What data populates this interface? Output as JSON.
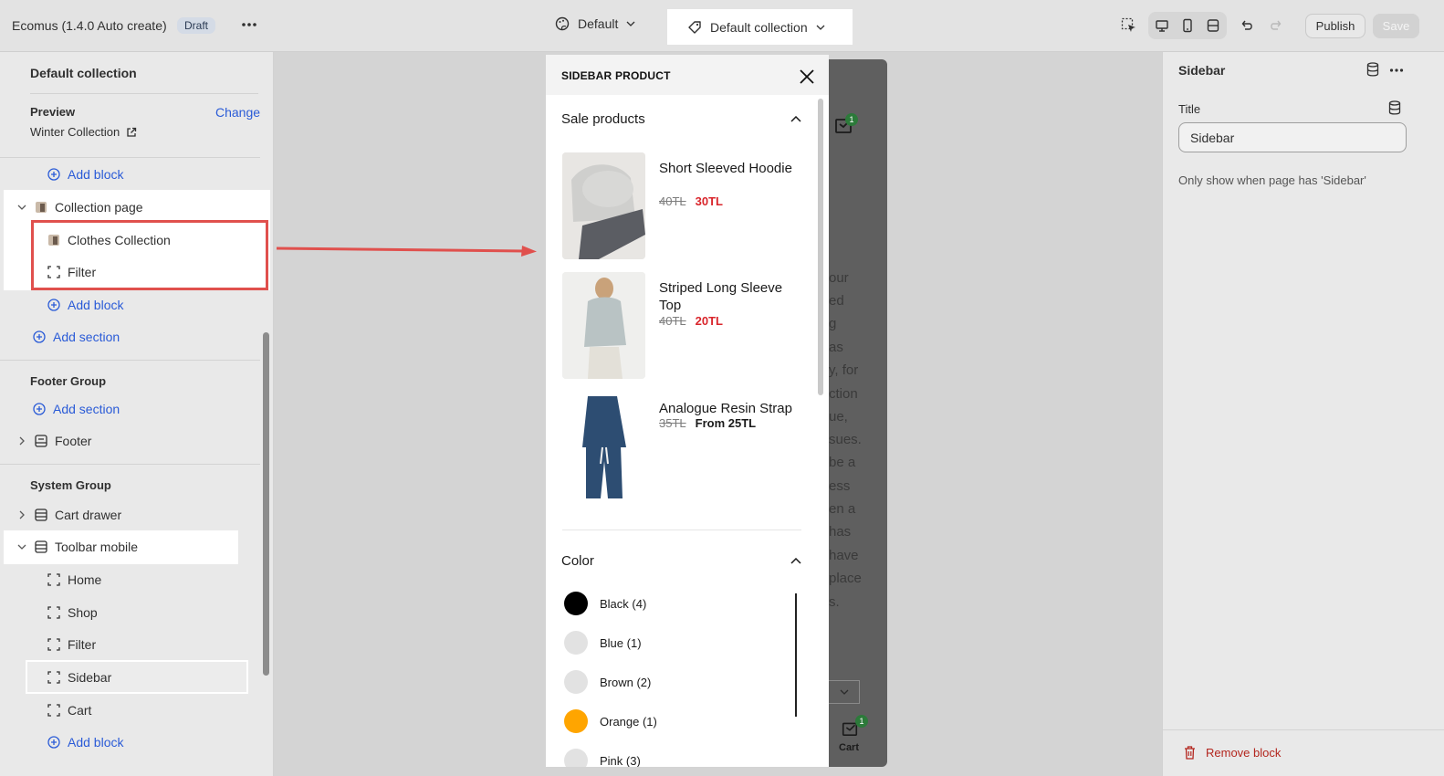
{
  "topbar": {
    "app_title": "Ecomus (1.4.0 Auto create)",
    "status_badge": "Draft",
    "theme_select": "Default",
    "template_select": "Default collection",
    "publish_label": "Publish",
    "save_label": "Save"
  },
  "left_panel": {
    "title": "Default collection",
    "preview_label": "Preview",
    "change_label": "Change",
    "preview_value": "Winter Collection",
    "add_block": "Add block",
    "add_section": "Add section",
    "collection_page": "Collection page",
    "clothes_collection": "Clothes Collection",
    "filter": "Filter",
    "footer_group": "Footer Group",
    "footer": "Footer",
    "system_group": "System Group",
    "cart_drawer": "Cart drawer",
    "toolbar_mobile": "Toolbar mobile",
    "toolbar_items": [
      "Home",
      "Shop",
      "Filter",
      "Sidebar",
      "Cart"
    ]
  },
  "drawer": {
    "title": "SIDEBAR PRODUCT",
    "sale_section": "Sale products",
    "products": [
      {
        "name": "Short Sleeved Hoodie",
        "old_price": "40TL",
        "new_price": "30TL"
      },
      {
        "name": "Striped Long Sleeve Top",
        "old_price": "40TL",
        "new_price": "20TL"
      },
      {
        "name": "Analogue Resin Strap",
        "old_price": "35TL",
        "new_price": "From 25TL"
      }
    ],
    "color_section": "Color",
    "colors": [
      {
        "label": "Black (4)",
        "hex": "#000000"
      },
      {
        "label": "Blue (1)",
        "hex": "#e2e2e2"
      },
      {
        "label": "Brown (2)",
        "hex": "#e2e2e2"
      },
      {
        "label": "Orange (1)",
        "hex": "#ffa500"
      },
      {
        "label": "Pink (3)",
        "hex": "#e2e2e2"
      }
    ]
  },
  "background_preview": {
    "text_fragments": [
      "our",
      "ed",
      "g",
      "as",
      "y, for",
      "ction",
      "ue,",
      "sues.",
      "be a",
      "ess",
      "en a",
      "has",
      "have",
      "place",
      "s."
    ],
    "cart_badge": "1",
    "cart_label": "Cart"
  },
  "right_panel": {
    "title": "Sidebar",
    "field_label": "Title",
    "field_value": "Sidebar",
    "help_text": "Only show when page has 'Sidebar'",
    "remove_label": "Remove block"
  },
  "colors": {
    "accent_link": "#2a5bd7",
    "annotation_red": "#e0504d",
    "sale_red": "#d9262c",
    "remove_red": "#b3261e"
  }
}
